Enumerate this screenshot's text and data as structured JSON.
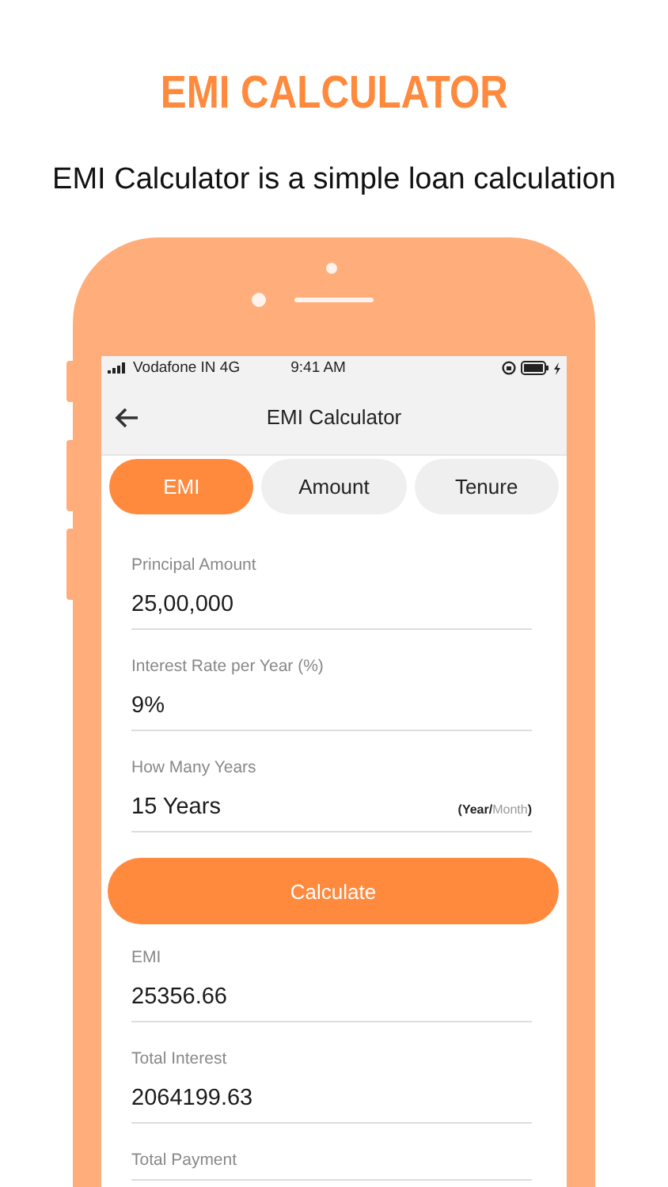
{
  "headline": "EMI CALCULATOR",
  "subtitle": "EMI Calculator is a simple loan calculation",
  "status_bar": {
    "carrier": "Vodafone IN 4G",
    "time": "9:41 AM"
  },
  "nav": {
    "title": "EMI Calculator"
  },
  "tabs": [
    {
      "label": "EMI",
      "selected": true
    },
    {
      "label": "Amount",
      "selected": false
    },
    {
      "label": "Tenure",
      "selected": false
    }
  ],
  "inputs": [
    {
      "label": "Principal Amount",
      "value": "25,00,000"
    },
    {
      "label": "Interest Rate per Year (%)",
      "value": "9%"
    },
    {
      "label": "How Many Years",
      "value": "15 Years",
      "unit_toggle": {
        "open": "(",
        "separator": "/",
        "close": ")",
        "options": [
          {
            "label": "Year",
            "selected": true
          },
          {
            "label": "Month",
            "selected": false
          }
        ]
      }
    }
  ],
  "calculate_button": "Calculate",
  "results": [
    {
      "label": "EMI",
      "value": "25356.66"
    },
    {
      "label": "Total Interest",
      "value": "2064199.63"
    },
    {
      "label": "Total Payment"
    }
  ]
}
